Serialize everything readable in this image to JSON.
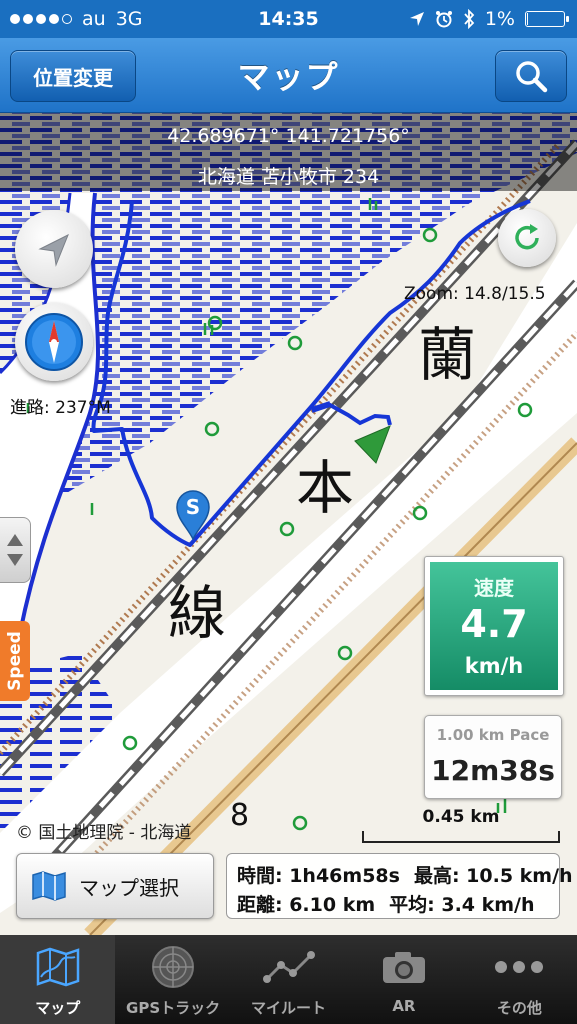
{
  "status_bar": {
    "carrier": "au",
    "network": "3G",
    "time": "14:35",
    "battery": "1%",
    "battery_level": 0.01
  },
  "navbar": {
    "title": "マップ",
    "location_button": "位置変更",
    "search_icon": "search-icon"
  },
  "map": {
    "coordinates": "42.689671° 141.721756°",
    "address": "北海道 苫小牧市 234",
    "zoom": "Zoom: 14.8/15.5",
    "heading": "進路: 237°M",
    "copyright": "© 国土地理院 - 北海道",
    "map_text": [
      "蘭",
      "本",
      "線",
      "8"
    ],
    "start_marker": "S",
    "speed_tab": "Speed"
  },
  "speed_card": {
    "label": "速度",
    "value": "4.7",
    "unit": "km/h"
  },
  "pace_card": {
    "label": "1.00 km Pace",
    "value": "12m38s"
  },
  "scale": {
    "label": "0.45 km"
  },
  "map_select": {
    "label": "マップ選択"
  },
  "stats": {
    "time": "時間: 1h46m58s",
    "max": "最高: 10.5 km/h",
    "distance": "距離: 6.10 km",
    "avg": "平均: 3.4 km/h"
  },
  "tabs": [
    {
      "label": "マップ",
      "icon": "map-icon",
      "active": true
    },
    {
      "label": "GPSトラック",
      "icon": "radar-icon",
      "active": false
    },
    {
      "label": "マイルート",
      "icon": "route-icon",
      "active": false
    },
    {
      "label": "AR",
      "icon": "camera-icon",
      "active": false
    },
    {
      "label": "その他",
      "icon": "more-icon",
      "active": false
    }
  ],
  "colors": {
    "nav_blue": "#1f73c8",
    "speed_green": "#2aa67c",
    "track_blue": "#1636d6",
    "speed_tab_orange": "#f07b2a",
    "wetland_blue": "#1c2fd0"
  }
}
